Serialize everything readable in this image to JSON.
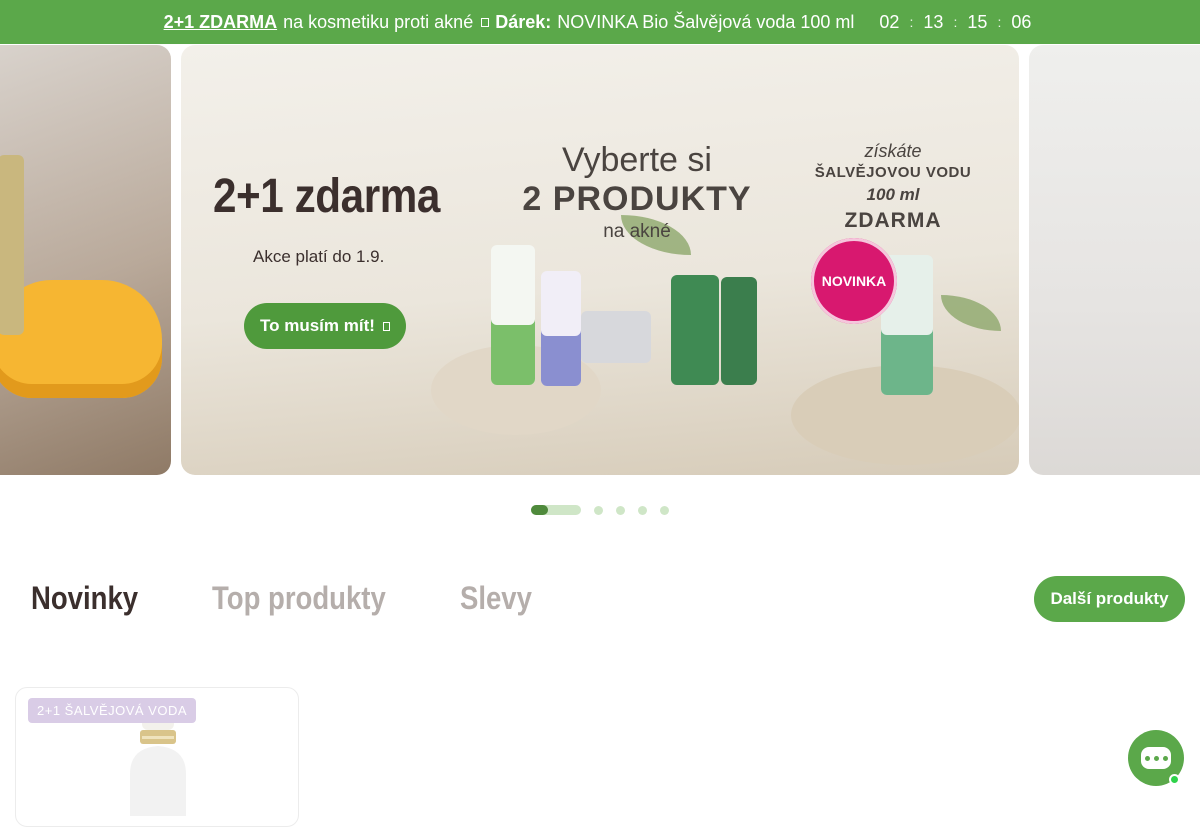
{
  "promo_bar": {
    "link_text": "2+1 ZDARMA",
    "text": "na kosmetiku proti akné",
    "gift_label": "Dárek:",
    "gift_text": "NOVINKA Bio Šalvějová voda 100 ml",
    "countdown": {
      "hours": "02",
      "minutes": "13",
      "seconds": "15",
      "fraction": "06"
    },
    "sep": ":",
    "color": "#5ba84a"
  },
  "hero": {
    "title": "2+1 zdarma",
    "subtitle": "Akce platí do 1.9.",
    "button_label": "To musím mít!",
    "headline_line1": "Vyberte si",
    "headline_line2": "2 PRODUKTY",
    "headline_line3": "na akné",
    "right_line1": "získáte",
    "right_line2": "ŠALVĚJOVOU VODU",
    "right_line3": "100 ml",
    "right_line4": "ZDARMA",
    "badge": "NOVINKA",
    "accent_color": "#4f9a3c",
    "badge_color": "#d8186f"
  },
  "carousel": {
    "slides_count": 5,
    "active_index": 0
  },
  "tabs": {
    "items": [
      {
        "label": "Novinky",
        "active": true
      },
      {
        "label": "Top produkty",
        "active": false
      },
      {
        "label": "Slevy",
        "active": false
      }
    ],
    "more_button": "Další produkty"
  },
  "products": [
    {
      "badge": "2+1 ŠALVĚJOVÁ VODA"
    }
  ],
  "chat": {
    "icon": "chat-icon",
    "status": "online"
  }
}
